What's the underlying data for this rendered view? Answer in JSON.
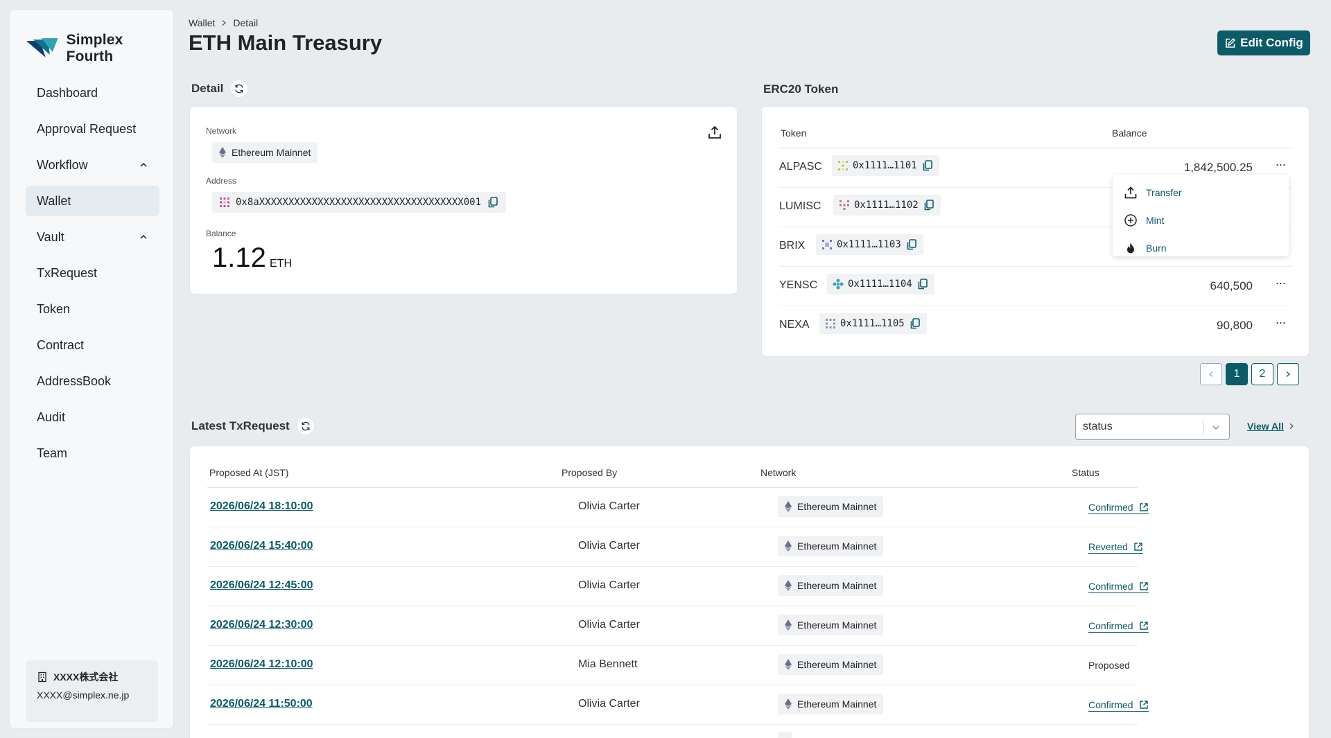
{
  "app": {
    "name": "Simplex Fourth"
  },
  "sidebar": {
    "items": [
      {
        "label": "Dashboard"
      },
      {
        "label": "Approval Request"
      },
      {
        "label": "Workflow"
      },
      {
        "label": "Wallet"
      },
      {
        "label": "Vault"
      },
      {
        "label": "TxRequest"
      },
      {
        "label": "Token"
      },
      {
        "label": "Contract"
      },
      {
        "label": "AddressBook"
      },
      {
        "label": "Audit"
      },
      {
        "label": "Team"
      }
    ],
    "account": {
      "company": "XXXX株式会社",
      "email": "XXXX@simplex.ne.jp"
    }
  },
  "header": {
    "breadcrumb": [
      "Wallet",
      "Detail"
    ],
    "title": "ETH Main Treasury",
    "edit_label": "Edit Config"
  },
  "detail": {
    "section_title": "Detail",
    "network_label": "Network",
    "network": "Ethereum Mainnet",
    "address_label": "Address",
    "address": "0x8aXXXXXXXXXXXXXXXXXXXXXXXXXXXXXXXXXXX001",
    "balance_label": "Balance",
    "balance": "1.12",
    "unit": "ETH"
  },
  "erc20": {
    "section_title": "ERC20 Token",
    "col_token": "Token",
    "col_balance": "Balance",
    "rows": [
      {
        "name": "ALPASC",
        "address": "0x1111…1101",
        "balance": "1,842,500.25",
        "icon_color": "#b5c94a"
      },
      {
        "name": "LUMISC",
        "address": "0x1111…1102",
        "balance": "",
        "icon_color": "#c9727a"
      },
      {
        "name": "BRIX",
        "address": "0x1111…1103",
        "balance": "",
        "icon_color": "#6a72d6"
      },
      {
        "name": "YENSC",
        "address": "0x1111…1104",
        "balance": "640,500",
        "icon_color": "#3aa6b0"
      },
      {
        "name": "NEXA",
        "address": "0x1111…1105",
        "balance": "90,800",
        "icon_color": "#8a8fb0"
      }
    ],
    "menu": [
      "Transfer",
      "Mint",
      "Burn"
    ],
    "pages": [
      "1",
      "2"
    ]
  },
  "tx": {
    "section_title": "Latest TxRequest",
    "filter_value": "status",
    "view_all": "View All",
    "columns": [
      "Proposed At (JST)",
      "Proposed By",
      "Network",
      "Status"
    ],
    "rows": [
      {
        "date": "2026/06/24 18:10:00",
        "by": "Olivia Carter",
        "network": "Ethereum Mainnet",
        "status": "Confirmed"
      },
      {
        "date": "2026/06/24 15:40:00",
        "by": "Olivia Carter",
        "network": "Ethereum Mainnet",
        "status": "Reverted"
      },
      {
        "date": "2026/06/24 12:45:00",
        "by": "Olivia Carter",
        "network": "Ethereum Mainnet",
        "status": "Confirmed"
      },
      {
        "date": "2026/06/24 12:30:00",
        "by": "Olivia Carter",
        "network": "Ethereum Mainnet",
        "status": "Confirmed"
      },
      {
        "date": "2026/06/24 12:10:00",
        "by": "Mia Bennett",
        "network": "Ethereum Mainnet",
        "status": "Proposed"
      },
      {
        "date": "2026/06/24 11:50:00",
        "by": "Olivia Carter",
        "network": "Ethereum Mainnet",
        "status": "Confirmed"
      }
    ]
  },
  "colors": {
    "accent": "#0b5c68",
    "background": "#e9ecef"
  }
}
